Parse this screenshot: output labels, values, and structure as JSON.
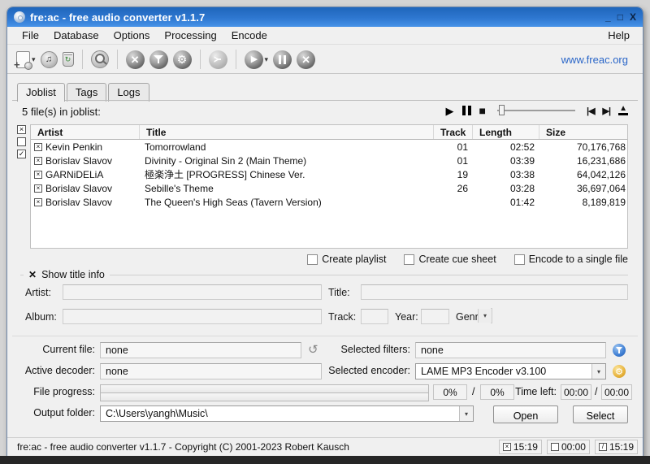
{
  "window": {
    "title": "fre:ac - free audio converter v1.1.7",
    "minimize": "_",
    "maximize": "□",
    "close": "X"
  },
  "menu": {
    "file": "File",
    "database": "Database",
    "options": "Options",
    "processing": "Processing",
    "encode": "Encode",
    "help": "Help"
  },
  "toolbar": {
    "website_link": "www.freac.org"
  },
  "tabs": {
    "joblist": "Joblist",
    "tags": "Tags",
    "logs": "Logs"
  },
  "joblist": {
    "count_label": "5 file(s) in joblist:",
    "columns": {
      "artist": "Artist",
      "title": "Title",
      "track": "Track",
      "length": "Length",
      "size": "Size"
    },
    "rows": [
      {
        "artist": "Kevin Penkin",
        "title": "Tomorrowland",
        "track": "01",
        "length": "02:52",
        "size": "70,176,768"
      },
      {
        "artist": "Borislav Slavov",
        "title": "Divinity - Original Sin 2 (Main Theme)",
        "track": "01",
        "length": "03:39",
        "size": "16,231,686"
      },
      {
        "artist": "GARNiDELiA",
        "title": "極楽浄土 [PROGRESS] Chinese Ver.",
        "track": "19",
        "length": "03:38",
        "size": "64,042,126"
      },
      {
        "artist": "Borislav Slavov",
        "title": "Sebille's Theme",
        "track": "26",
        "length": "03:28",
        "size": "36,697,064"
      },
      {
        "artist": "Borislav Slavov",
        "title": "The Queen's High Seas (Tavern Version)",
        "track": "",
        "length": "01:42",
        "size": "8,189,819"
      }
    ]
  },
  "options_row": {
    "create_playlist": "Create playlist",
    "create_cue_sheet": "Create cue sheet",
    "encode_single_file": "Encode to a single file"
  },
  "title_info": {
    "header": "Show title info",
    "artist": "Artist:",
    "album": "Album:",
    "title": "Title:",
    "track": "Track:",
    "year": "Year:",
    "genre": "Genre:"
  },
  "conversion": {
    "current_file_label": "Current file:",
    "current_file_value": "none",
    "active_decoder_label": "Active decoder:",
    "active_decoder_value": "none",
    "file_progress_label": "File progress:",
    "selected_filters_label": "Selected filters:",
    "selected_filters_value": "none",
    "selected_encoder_label": "Selected encoder:",
    "selected_encoder_value": "LAME MP3 Encoder v3.100",
    "total_progress": "0%",
    "file_progress": "0%",
    "slash": "/",
    "time_left_label": "Time left:",
    "time_left_value": "00:00",
    "time_total_value": "00:00",
    "output_folder_label": "Output folder:",
    "output_folder_value": "C:\\Users\\yangh\\Music\\",
    "open_button": "Open",
    "select_button": "Select"
  },
  "statusbar": {
    "copyright": "fre:ac - free audio converter v1.1.7 - Copyright (C) 2001-2023 Robert Kausch",
    "time_a": "15:19",
    "time_b": "00:00",
    "time_c": "15:19"
  },
  "icons": {
    "play": "▶",
    "stop": "■",
    "previous": "|◀",
    "next": "▶|",
    "eject": "▲",
    "dropdown": "▾",
    "music_note": "♫",
    "gear": "⚙",
    "curved_arrow": "↻",
    "check_mark": "×",
    "tick_mark": "✓",
    "diag_mark": "/"
  },
  "colors": {
    "titlebar_top": "#1f66bb",
    "titlebar_bottom": "#4793e8",
    "link_blue": "#2a66c8",
    "filter_icon_blue": "#3f7fd4",
    "encoder_icon_gold": "#e7b33c"
  }
}
